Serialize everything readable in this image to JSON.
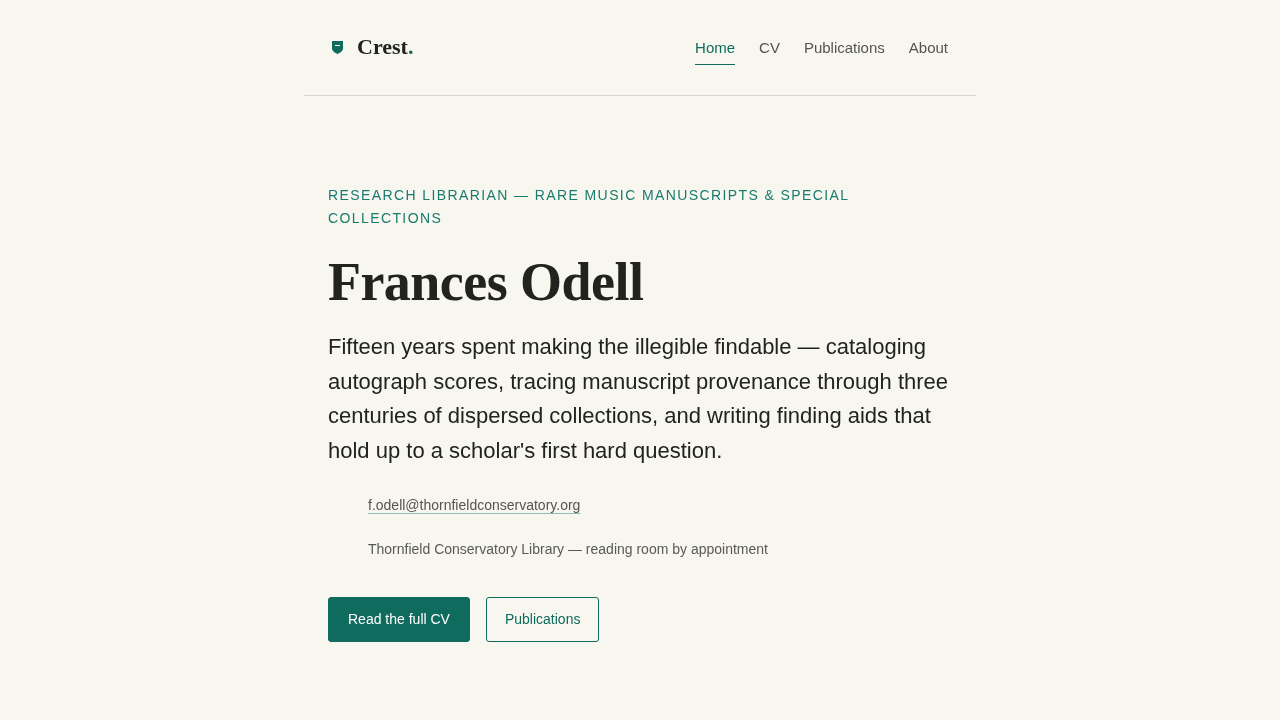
{
  "header": {
    "brand": {
      "text": "Crest",
      "accent": "."
    },
    "nav": [
      {
        "label": "Home",
        "selected": true
      },
      {
        "label": "CV",
        "selected": false
      },
      {
        "label": "Publications",
        "selected": false
      },
      {
        "label": "About",
        "selected": false
      }
    ]
  },
  "hero": {
    "eyebrow": "RESEARCH LIBRARIAN — RARE MUSIC MANUSCRIPTS & SPECIAL COLLECTIONS",
    "name": "Frances Odell",
    "lead": "Fifteen years spent making the illegible findable — cataloging autograph scores, tracing manuscript provenance through three centuries of dispersed collections, and writing finding aids that hold up to a scholar's first hard question.",
    "contacts": [
      {
        "kind": "link",
        "text": "f.odell@thornfieldconservatory.org"
      },
      {
        "kind": "text",
        "text": "Thornfield Conservatory Library — reading room by appointment"
      }
    ],
    "buttons": [
      {
        "kind": "primary",
        "label": "Read the full CV"
      },
      {
        "kind": "secondary",
        "label": "Publications"
      }
    ]
  }
}
